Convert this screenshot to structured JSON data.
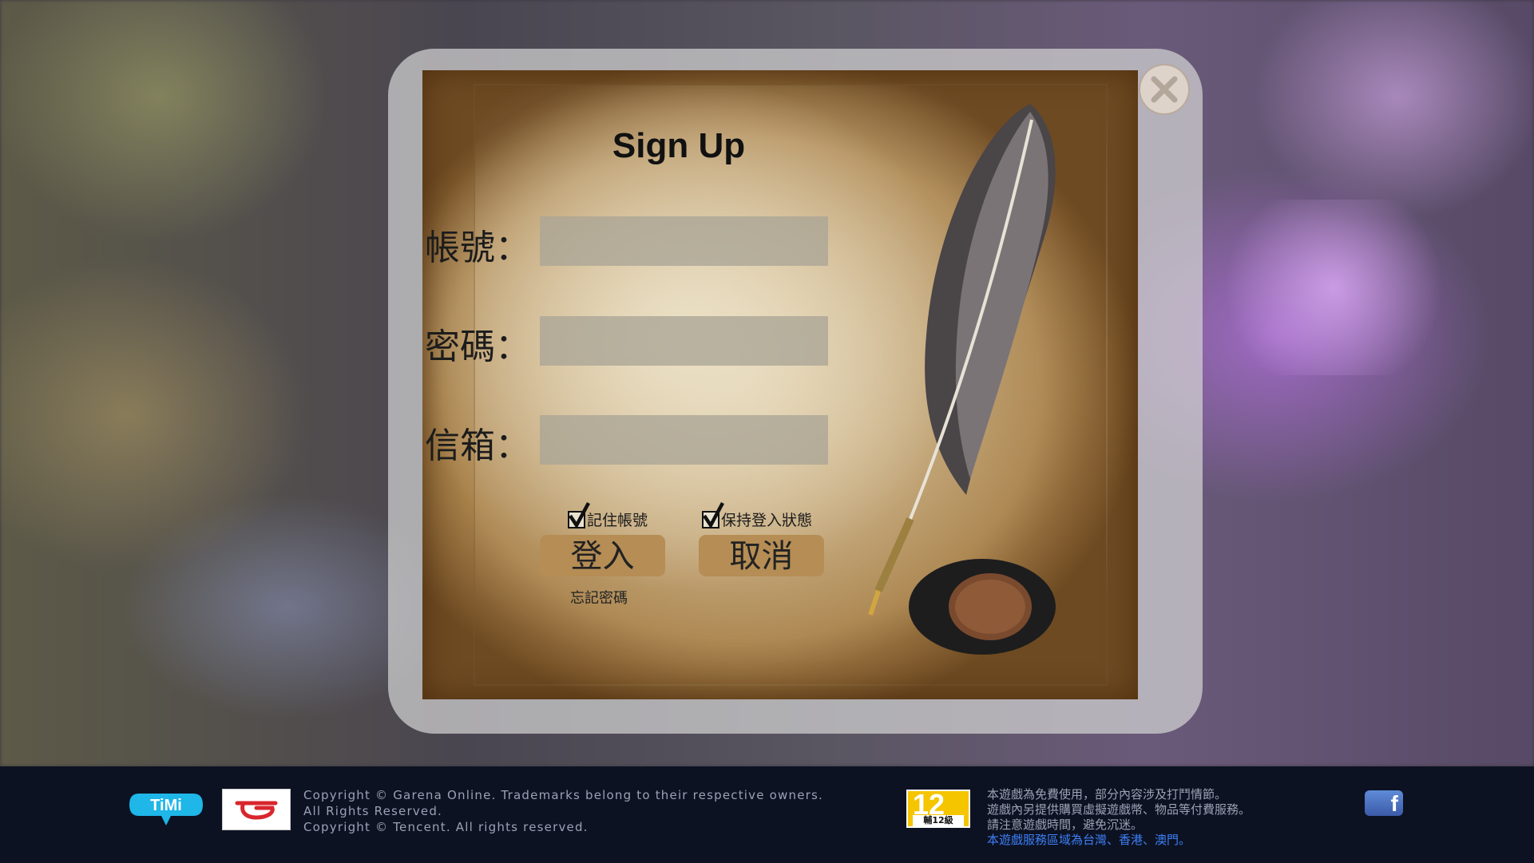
{
  "signup": {
    "title": "Sign Up",
    "account_label": "帳號：",
    "password_label": "密碼：",
    "email_label": "信箱：",
    "account_value": "",
    "password_value": "",
    "email_value": "",
    "remember_label": "記住帳號",
    "remember_checked": true,
    "keep_login_label": "保持登入狀態",
    "keep_login_checked": true,
    "login_button": "登入",
    "cancel_button": "取消",
    "forgot_link": "忘記密碼"
  },
  "footer": {
    "timi_logo_text": "TiMi",
    "copyright_lines": [
      "Copyright © Garena Online. Trademarks belong to their respective owners.",
      "All Rights Reserved.",
      "Copyright © Tencent. All rights reserved."
    ],
    "rating_number": "12",
    "rating_label": "輔12級",
    "notice_lines": [
      "本遊戲為免費使用，部分內容涉及打鬥情節。",
      "遊戲內另提供購買虛擬遊戲幣、物品等付費服務。",
      "請注意遊戲時間，避免沉迷。"
    ],
    "notice_region": "本遊戲服務區域為台灣、香港、澳門。",
    "facebook_text": "f"
  },
  "icons": {
    "close": "close-icon",
    "check": "check-icon",
    "facebook": "facebook-icon",
    "quill": "quill-icon"
  }
}
